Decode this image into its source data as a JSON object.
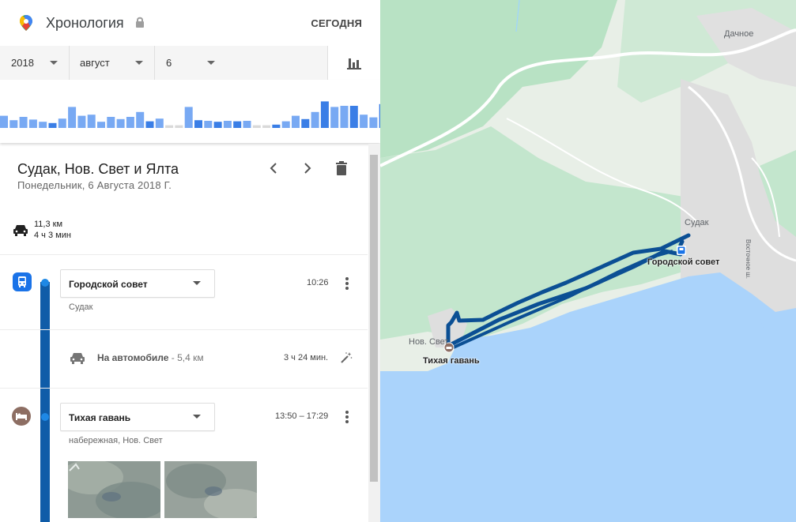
{
  "header": {
    "title": "Хронология",
    "today_label": "СЕГОДНЯ"
  },
  "selectors": {
    "year": "2018",
    "month": "август",
    "day": "6"
  },
  "histogram": {
    "levels": [
      0.55,
      0.35,
      0.5,
      0.38,
      0.28,
      0.22,
      0.42,
      0.95,
      0.55,
      0.6,
      0.28,
      0.5,
      0.4,
      0.5,
      0.72,
      0.3,
      0.42,
      0.12,
      0.12,
      0.95,
      0.35,
      0.32,
      0.28,
      0.32,
      0.3,
      0.32,
      0.12,
      0.12,
      0.15,
      0.3,
      0.55,
      0.4,
      0.72,
      1.2,
      0.95,
      1.0,
      1.0,
      0.6,
      0.48,
      1.08
    ],
    "dark_indices": [
      5,
      15,
      20,
      22,
      24,
      26,
      28,
      31,
      33,
      36,
      39
    ],
    "colors": {
      "light": "#78a9f3",
      "dark": "#3a7ee6",
      "empty": "#d9d9d9"
    }
  },
  "day": {
    "title": "Судак, Нов. Свет и Ялта",
    "date": "Понедельник, 6 Августа 2018 Г.",
    "distance": "11,3 км",
    "duration": "4 ч 3 мин"
  },
  "timeline": {
    "place1": {
      "name": "Городской совет",
      "time": "10:26",
      "locality": "Судак",
      "icon": "bus-stop-icon"
    },
    "move": {
      "mode": "На автомобиле",
      "distance": " - 5,4 км",
      "duration": "3 ч 24 мин."
    },
    "place2": {
      "name": "Тихая гавань",
      "time": "13:50 – 17:29",
      "locality": "набережная, Нов. Свет",
      "icon": "hotel-bed-icon"
    }
  },
  "map": {
    "labels": {
      "dachnoe": "Дачное",
      "sudak": "Судак",
      "vostochnoe": "Восточное ш.",
      "gorsovet": "Городской совет",
      "novsvet": "Нов. Свет",
      "tikhaya": "Тихая гавань"
    },
    "colors": {
      "sea": "#aad3fb",
      "land": "#e8efe7",
      "forest": "#b8e2c4",
      "town": "#dedede",
      "route": "#0b4f94",
      "accent_blue": "#1a73e8",
      "hotel_brown": "#8d6e63"
    }
  }
}
